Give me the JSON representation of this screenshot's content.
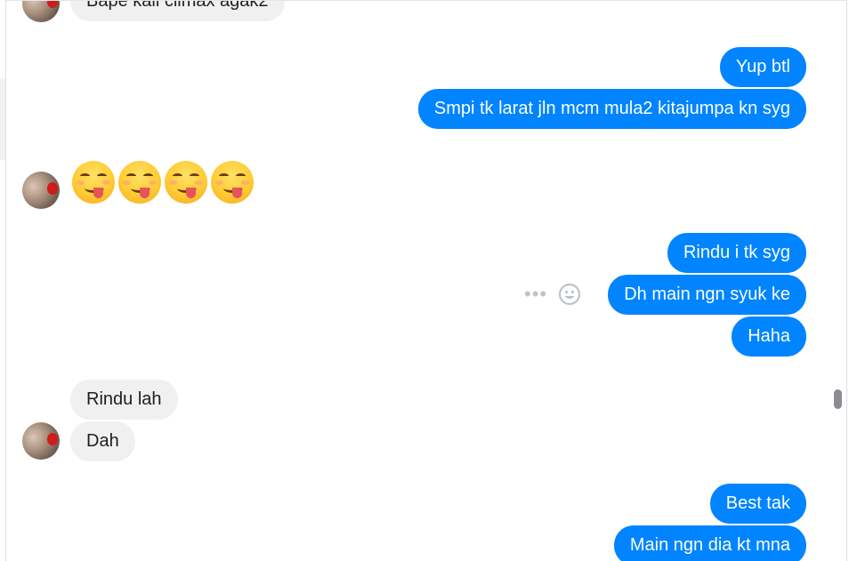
{
  "thread": {
    "messages": [
      {
        "side": "in",
        "text": "Bape kali climax agak2"
      },
      {
        "side": "out",
        "text": "Yup btl"
      },
      {
        "side": "out",
        "text": "Smpi tk larat jln mcm mula2 kitajumpa kn syg"
      },
      {
        "side": "in",
        "type": "emoji",
        "count": 4,
        "emoji": "face-savoring-food"
      },
      {
        "side": "out",
        "text": "Rindu i tk syg"
      },
      {
        "side": "out",
        "text": "Dh main ngn syuk ke"
      },
      {
        "side": "out",
        "text": "Haha"
      },
      {
        "side": "in",
        "text": "Rindu lah"
      },
      {
        "side": "in",
        "text": "Dah"
      },
      {
        "side": "out",
        "text": "Best tak"
      },
      {
        "side": "out",
        "text": "Main ngn dia kt mna"
      }
    ]
  },
  "colors": {
    "outgoing_bubble": "#0084ff",
    "incoming_bubble": "#f1f0f0"
  },
  "icons": {
    "more": "more-options-icon",
    "react": "smiley-react-icon"
  }
}
